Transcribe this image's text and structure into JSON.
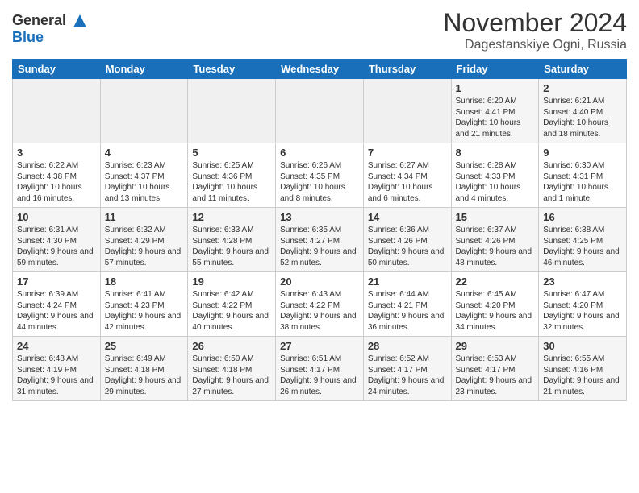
{
  "header": {
    "logo_line1": "General",
    "logo_line2": "Blue",
    "month": "November 2024",
    "location": "Dagestanskiye Ogni, Russia"
  },
  "days_of_week": [
    "Sunday",
    "Monday",
    "Tuesday",
    "Wednesday",
    "Thursday",
    "Friday",
    "Saturday"
  ],
  "weeks": [
    [
      {
        "day": "",
        "text": ""
      },
      {
        "day": "",
        "text": ""
      },
      {
        "day": "",
        "text": ""
      },
      {
        "day": "",
        "text": ""
      },
      {
        "day": "",
        "text": ""
      },
      {
        "day": "1",
        "text": "Sunrise: 6:20 AM\nSunset: 4:41 PM\nDaylight: 10 hours and 21 minutes."
      },
      {
        "day": "2",
        "text": "Sunrise: 6:21 AM\nSunset: 4:40 PM\nDaylight: 10 hours and 18 minutes."
      }
    ],
    [
      {
        "day": "3",
        "text": "Sunrise: 6:22 AM\nSunset: 4:38 PM\nDaylight: 10 hours and 16 minutes."
      },
      {
        "day": "4",
        "text": "Sunrise: 6:23 AM\nSunset: 4:37 PM\nDaylight: 10 hours and 13 minutes."
      },
      {
        "day": "5",
        "text": "Sunrise: 6:25 AM\nSunset: 4:36 PM\nDaylight: 10 hours and 11 minutes."
      },
      {
        "day": "6",
        "text": "Sunrise: 6:26 AM\nSunset: 4:35 PM\nDaylight: 10 hours and 8 minutes."
      },
      {
        "day": "7",
        "text": "Sunrise: 6:27 AM\nSunset: 4:34 PM\nDaylight: 10 hours and 6 minutes."
      },
      {
        "day": "8",
        "text": "Sunrise: 6:28 AM\nSunset: 4:33 PM\nDaylight: 10 hours and 4 minutes."
      },
      {
        "day": "9",
        "text": "Sunrise: 6:30 AM\nSunset: 4:31 PM\nDaylight: 10 hours and 1 minute."
      }
    ],
    [
      {
        "day": "10",
        "text": "Sunrise: 6:31 AM\nSunset: 4:30 PM\nDaylight: 9 hours and 59 minutes."
      },
      {
        "day": "11",
        "text": "Sunrise: 6:32 AM\nSunset: 4:29 PM\nDaylight: 9 hours and 57 minutes."
      },
      {
        "day": "12",
        "text": "Sunrise: 6:33 AM\nSunset: 4:28 PM\nDaylight: 9 hours and 55 minutes."
      },
      {
        "day": "13",
        "text": "Sunrise: 6:35 AM\nSunset: 4:27 PM\nDaylight: 9 hours and 52 minutes."
      },
      {
        "day": "14",
        "text": "Sunrise: 6:36 AM\nSunset: 4:26 PM\nDaylight: 9 hours and 50 minutes."
      },
      {
        "day": "15",
        "text": "Sunrise: 6:37 AM\nSunset: 4:26 PM\nDaylight: 9 hours and 48 minutes."
      },
      {
        "day": "16",
        "text": "Sunrise: 6:38 AM\nSunset: 4:25 PM\nDaylight: 9 hours and 46 minutes."
      }
    ],
    [
      {
        "day": "17",
        "text": "Sunrise: 6:39 AM\nSunset: 4:24 PM\nDaylight: 9 hours and 44 minutes."
      },
      {
        "day": "18",
        "text": "Sunrise: 6:41 AM\nSunset: 4:23 PM\nDaylight: 9 hours and 42 minutes."
      },
      {
        "day": "19",
        "text": "Sunrise: 6:42 AM\nSunset: 4:22 PM\nDaylight: 9 hours and 40 minutes."
      },
      {
        "day": "20",
        "text": "Sunrise: 6:43 AM\nSunset: 4:22 PM\nDaylight: 9 hours and 38 minutes."
      },
      {
        "day": "21",
        "text": "Sunrise: 6:44 AM\nSunset: 4:21 PM\nDaylight: 9 hours and 36 minutes."
      },
      {
        "day": "22",
        "text": "Sunrise: 6:45 AM\nSunset: 4:20 PM\nDaylight: 9 hours and 34 minutes."
      },
      {
        "day": "23",
        "text": "Sunrise: 6:47 AM\nSunset: 4:20 PM\nDaylight: 9 hours and 32 minutes."
      }
    ],
    [
      {
        "day": "24",
        "text": "Sunrise: 6:48 AM\nSunset: 4:19 PM\nDaylight: 9 hours and 31 minutes."
      },
      {
        "day": "25",
        "text": "Sunrise: 6:49 AM\nSunset: 4:18 PM\nDaylight: 9 hours and 29 minutes."
      },
      {
        "day": "26",
        "text": "Sunrise: 6:50 AM\nSunset: 4:18 PM\nDaylight: 9 hours and 27 minutes."
      },
      {
        "day": "27",
        "text": "Sunrise: 6:51 AM\nSunset: 4:17 PM\nDaylight: 9 hours and 26 minutes."
      },
      {
        "day": "28",
        "text": "Sunrise: 6:52 AM\nSunset: 4:17 PM\nDaylight: 9 hours and 24 minutes."
      },
      {
        "day": "29",
        "text": "Sunrise: 6:53 AM\nSunset: 4:17 PM\nDaylight: 9 hours and 23 minutes."
      },
      {
        "day": "30",
        "text": "Sunrise: 6:55 AM\nSunset: 4:16 PM\nDaylight: 9 hours and 21 minutes."
      }
    ]
  ]
}
